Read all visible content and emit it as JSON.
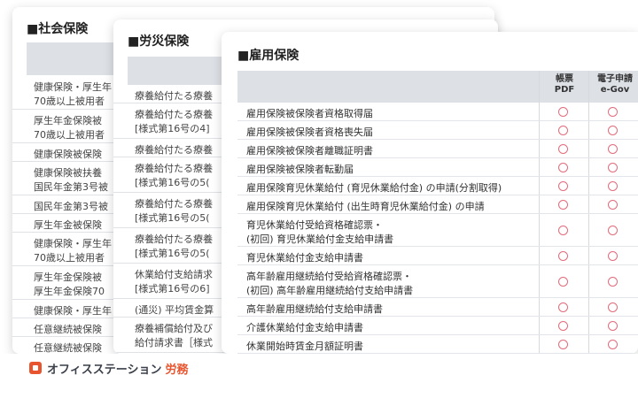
{
  "card1": {
    "title": "■社会保険",
    "rows": [
      [
        "健康保険・厚生年",
        "70歳以上被用者"
      ],
      [
        "厚生年金保険被",
        "70歳以上被用者"
      ],
      [
        "健康保険被保険"
      ],
      [
        "健康保険被扶養",
        "国民年金第3号被"
      ],
      [
        "国民年金第3号被"
      ],
      [
        "厚生年金被保険"
      ],
      [
        "健康保険・厚生年",
        "70歳以上被用者"
      ],
      [
        "厚生年金保険被",
        "厚生年金保険70"
      ],
      [
        "健康保険・厚生年"
      ],
      [
        "任意継続被保険"
      ],
      [
        "任意継続被保険"
      ]
    ]
  },
  "card2": {
    "title": "■労災保険",
    "rows": [
      [
        "療養給付たる療養"
      ],
      [
        "療養給付たる療養",
        "[様式第16号の4]"
      ],
      [
        "療養給付たる療養"
      ],
      [
        "療養給付たる療養",
        "[様式第16号の5("
      ],
      [
        "療養給付たる療養",
        "[様式第16号の5("
      ],
      [
        "療養給付たる療養",
        "[様式第16号の5("
      ],
      [
        "休業給付支給請求",
        "[様式第16号の6]"
      ],
      [
        "(通災) 平均賃金算"
      ],
      [
        "療養補償給付及び",
        "給付請求書［様式"
      ]
    ]
  },
  "card3": {
    "title": "■雇用保険",
    "col1": [
      "帳票",
      "PDF"
    ],
    "col2": [
      "電子申請",
      "e-Gov"
    ],
    "rows": [
      [
        "雇用保険被保険者資格取得届"
      ],
      [
        "雇用保険被保険者資格喪失届"
      ],
      [
        "雇用保険被保険者離職証明書"
      ],
      [
        "雇用保険被保険者転勤届"
      ],
      [
        "雇用保険育児休業給付 (育児休業給付金) の申請(分割取得)"
      ],
      [
        "雇用保険育児休業給付 (出生時育児休業給付金) の申請"
      ],
      [
        "育児休業給付受給資格確認票・",
        "(初回) 育児休業給付金支給申請書"
      ],
      [
        "育児休業給付金支給申請書"
      ],
      [
        "高年齢雇用継続給付受給資格確認票・",
        "(初回) 高年齢雇用継続給付支給申請書"
      ],
      [
        "高年齢雇用継続給付支給申請書"
      ],
      [
        "介護休業給付金支給申請書"
      ],
      [
        "休業開始時賃金月額証明書"
      ]
    ]
  },
  "footer": {
    "brand": "オフィスステーション",
    "sub": "労務"
  },
  "colors": {
    "accent": "#e8542e",
    "circle": "#e36b7a",
    "header_band": "#dde1e6"
  }
}
